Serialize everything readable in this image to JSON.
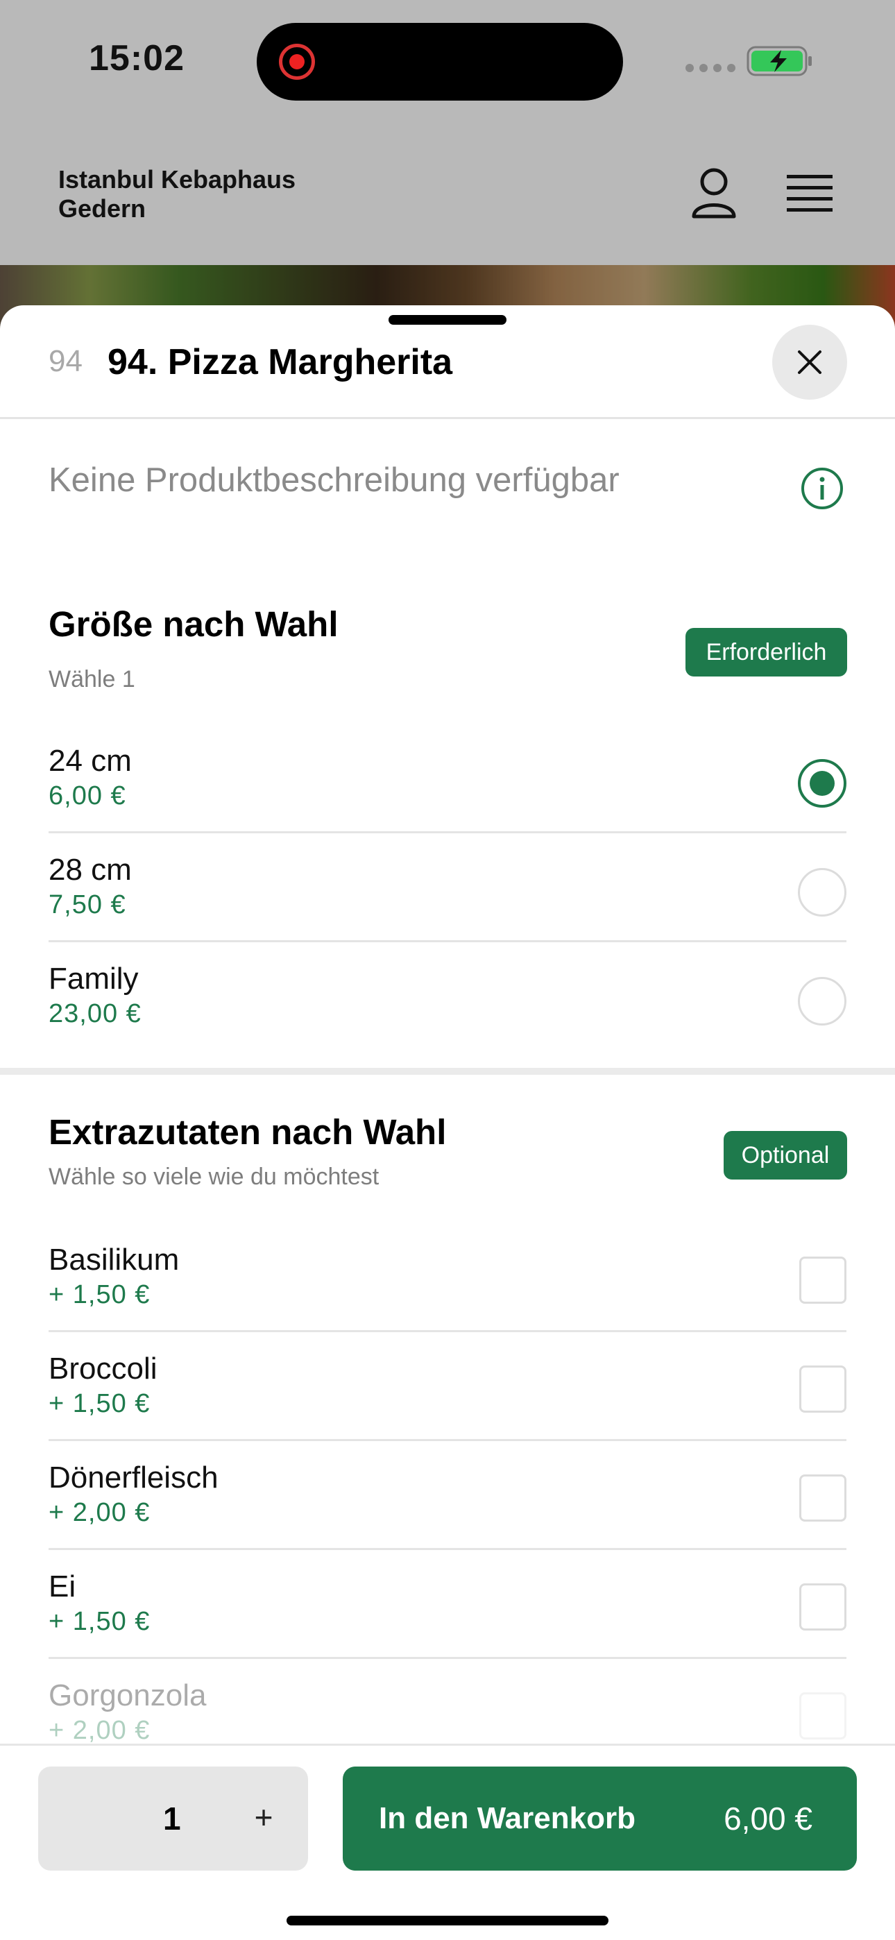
{
  "status_bar": {
    "time": "15:02"
  },
  "header": {
    "brand_line1": "Istanbul Kebaphaus",
    "brand_line2": "Gedern"
  },
  "item": {
    "number": "94",
    "title": "94. Pizza Margherita",
    "description": "Keine Produktbeschreibung verfügbar"
  },
  "size_group": {
    "title": "Größe nach Wahl",
    "subtitle": "Wähle 1",
    "badge": "Erforderlich",
    "options": [
      {
        "name": "24 cm",
        "price": "6,00 €",
        "selected": true
      },
      {
        "name": "28 cm",
        "price": "7,50 €",
        "selected": false
      },
      {
        "name": "Family",
        "price": "23,00 €",
        "selected": false
      }
    ]
  },
  "extras_group": {
    "title": "Extrazutaten nach Wahl",
    "subtitle": "Wähle so viele wie du möchtest",
    "badge": "Optional",
    "options": [
      {
        "name": "Basilikum",
        "price": "+ 1,50 €"
      },
      {
        "name": "Broccoli",
        "price": "+ 1,50 €"
      },
      {
        "name": "Dönerfleisch",
        "price": "+ 2,00 €"
      },
      {
        "name": "Ei",
        "price": "+ 1,50 €"
      },
      {
        "name": "Gorgonzola",
        "price": "+ 2,00 €"
      }
    ]
  },
  "footer": {
    "quantity": "1",
    "plus_label": "+",
    "add_label": "In den Warenkorb",
    "total": "6,00 €"
  },
  "colors": {
    "accent": "#1e7a4c",
    "dim_background": "#b9b9b9"
  }
}
